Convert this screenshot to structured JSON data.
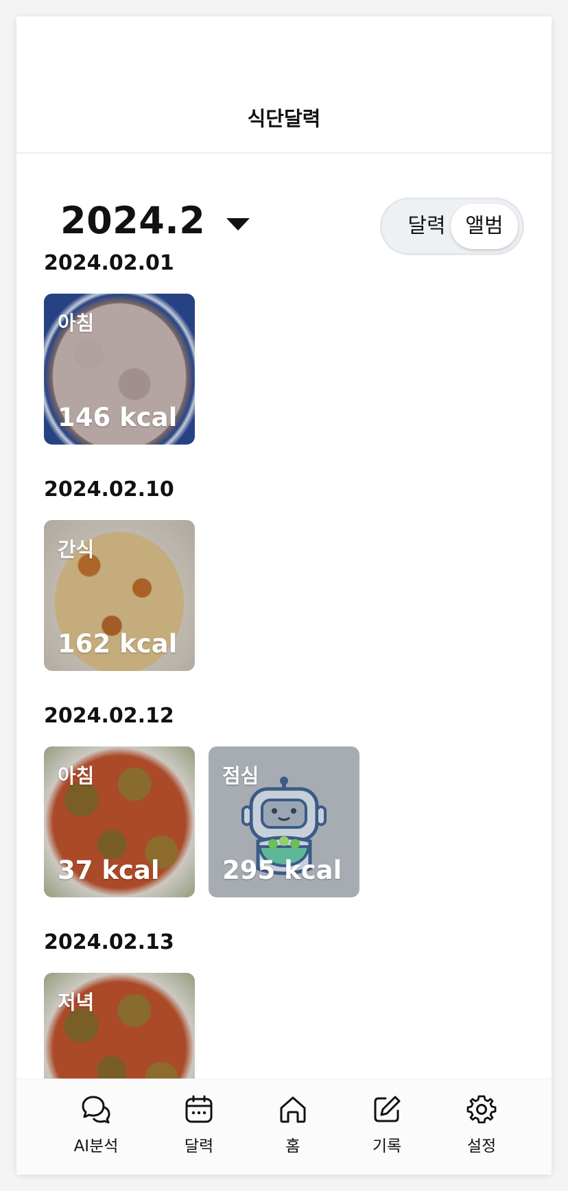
{
  "header": {
    "title": "식단달력"
  },
  "controls": {
    "month": "2024.2",
    "toggle": {
      "calendar_label": "달력",
      "album_label": "앨범",
      "selected": "앨범"
    }
  },
  "days": [
    {
      "date": "2024.02.01",
      "meals": [
        {
          "meal": "아침",
          "kcal": "146 kcal",
          "image": "rice"
        }
      ]
    },
    {
      "date": "2024.02.10",
      "meals": [
        {
          "meal": "간식",
          "kcal": "162 kcal",
          "image": "pasta"
        }
      ]
    },
    {
      "date": "2024.02.12",
      "meals": [
        {
          "meal": "아침",
          "kcal": "37 kcal",
          "image": "cucumber-salad"
        },
        {
          "meal": "점심",
          "kcal": "295 kcal",
          "image": "robot-placeholder"
        }
      ]
    },
    {
      "date": "2024.02.13",
      "meals": [
        {
          "meal": "저녁",
          "kcal": "",
          "image": "cucumber-salad"
        }
      ]
    }
  ],
  "tabbar": {
    "items": [
      {
        "label": "AI분석",
        "icon": "chat-bubbles-icon"
      },
      {
        "label": "달력",
        "icon": "calendar-icon"
      },
      {
        "label": "홈",
        "icon": "home-icon"
      },
      {
        "label": "기록",
        "icon": "edit-icon"
      },
      {
        "label": "설정",
        "icon": "gear-icon"
      }
    ]
  },
  "colors": {
    "accent_text": "#111111",
    "toggle_bg": "#eef1f4",
    "placeholder_card": "#a7acb3"
  }
}
